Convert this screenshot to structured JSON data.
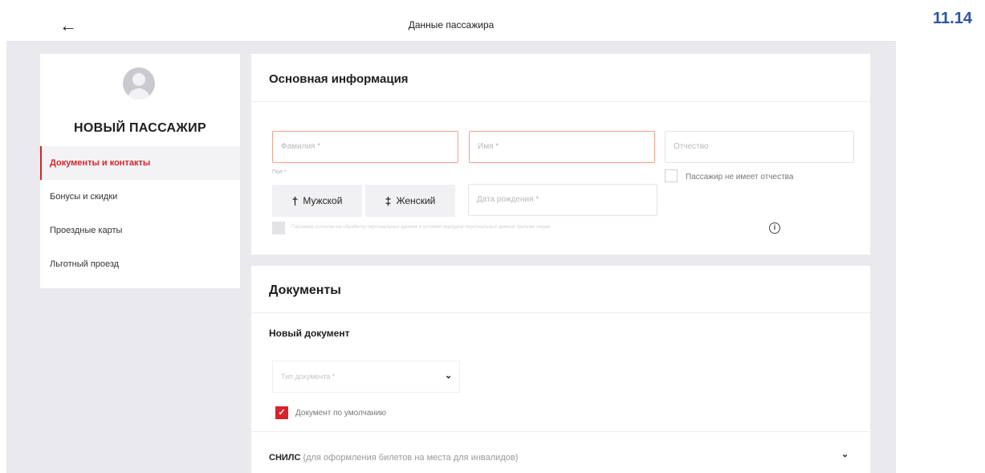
{
  "header": {
    "back_icon": "arrow-left-icon",
    "title": "Данные пассажира"
  },
  "page_number": "11.14",
  "sidebar": {
    "avatar_icon": "user-avatar-icon",
    "passenger_title": "НОВЫЙ ПАССАЖИР",
    "items": [
      {
        "label": "Документы и контакты",
        "active": true
      },
      {
        "label": "Бонусы и скидки",
        "active": false
      },
      {
        "label": "Проездные карты",
        "active": false
      },
      {
        "label": "Льготный проезд",
        "active": false
      }
    ]
  },
  "basic_info": {
    "title": "Основная информация",
    "surname_placeholder": "Фамилия *",
    "name_placeholder": "Имя *",
    "patronymic_placeholder": "Отчество",
    "no_patronymic_label": "Пассажир не имеет отчества",
    "gender_label": "Пол *",
    "male_label": "Мужской",
    "female_label": "Женский",
    "birthdate_placeholder": "Дата рождения *",
    "consent_text": "Пассажир согласен на обработку персональных данных и условия передачи персональных данных третьим лицам"
  },
  "documents": {
    "title": "Документы",
    "new_document_title": "Новый документ",
    "doc_type_placeholder": "Тип документа *",
    "default_doc_label": "Документ по умолчанию",
    "default_doc_checked": true,
    "snils_label": "СНИЛС",
    "snils_note": "(для оформления билетов на места для инвалидов)"
  },
  "colors": {
    "accent": "#d8232a",
    "error_border": "#f0a08a",
    "page_number": "#2a55a6"
  }
}
